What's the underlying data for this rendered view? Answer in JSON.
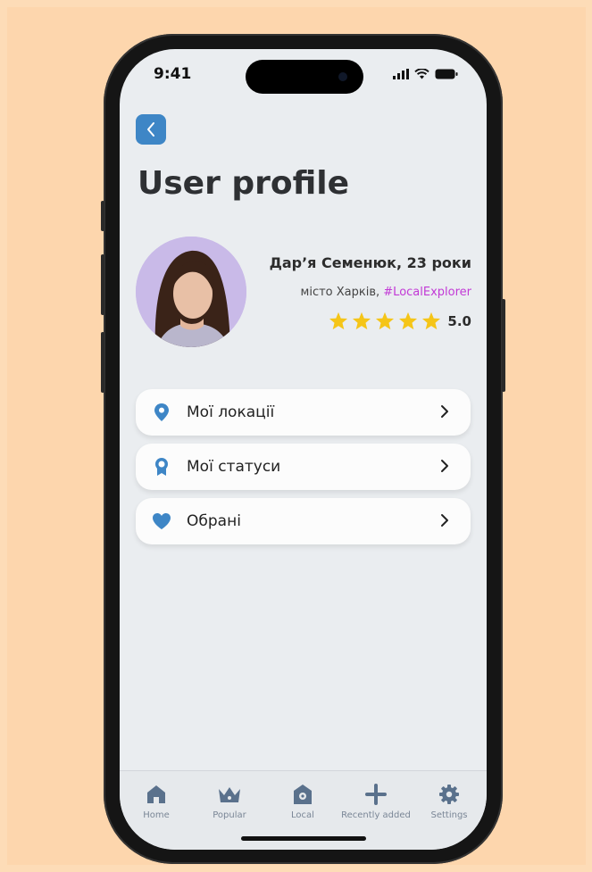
{
  "status_bar": {
    "time": "9:41"
  },
  "page": {
    "title": "User profile"
  },
  "profile": {
    "name": "Дар’я Семенюк, 23 роки",
    "city": "місто Харків,",
    "hashtag": "#LocalExplorer",
    "rating": "5.0",
    "stars_filled": 5,
    "stars_total": 5
  },
  "menu": [
    {
      "label": "Мої локації",
      "icon": "location-pin-icon"
    },
    {
      "label": "Мої статуси",
      "icon": "badge-icon"
    },
    {
      "label": "Обрані",
      "icon": "heart-icon"
    }
  ],
  "tabs": [
    {
      "label": "Home",
      "icon": "home-icon"
    },
    {
      "label": "Popular",
      "icon": "crown-icon"
    },
    {
      "label": "Local",
      "icon": "local-pin-icon"
    },
    {
      "label": "Recently added",
      "icon": "plus-icon"
    },
    {
      "label": "Settings",
      "icon": "gear-icon"
    }
  ],
  "colors": {
    "accent": "#3e86c6",
    "background": "#fdd6ad",
    "hashtag": "#c23ad6",
    "star": "#f5c518",
    "tab_icon": "#5a718c"
  }
}
